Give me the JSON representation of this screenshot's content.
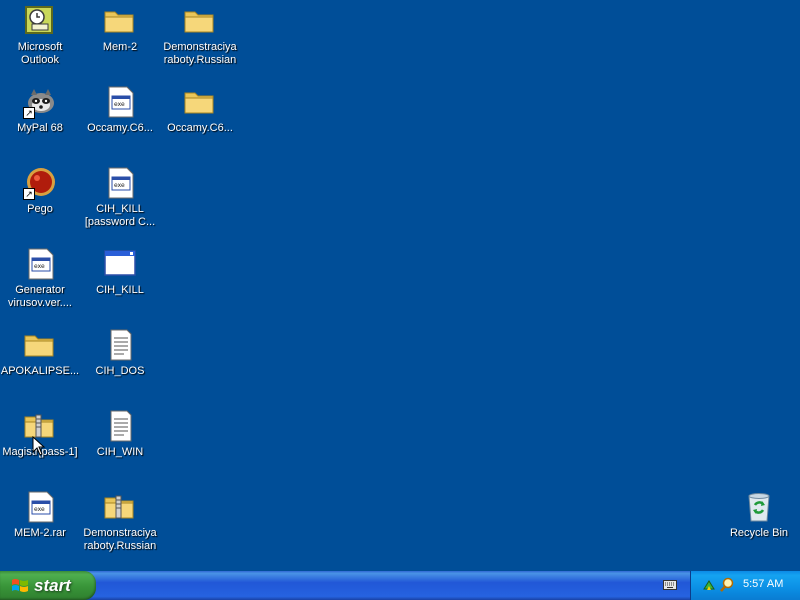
{
  "desktop": {
    "icons": [
      {
        "label": "Microsoft\nOutlook"
      },
      {
        "label": "Mem-2"
      },
      {
        "label": "Demonstraciya\nraboty.Russian"
      },
      {
        "label": "MyPal 68"
      },
      {
        "label": "Occamy.C6..."
      },
      {
        "label": "Occamy.C6..."
      },
      {
        "label": "Pego"
      },
      {
        "label": "CIH_KILL\n[password C..."
      },
      {
        "label": "Generator\nvirusov.ver...."
      },
      {
        "label": "CIH_KILL"
      },
      {
        "label": "APOKALIPSE..."
      },
      {
        "label": "CIH_DOS"
      },
      {
        "label": "Magistr[pass-1]"
      },
      {
        "label": "CIH_WIN"
      },
      {
        "label": "MEM-2.rar"
      },
      {
        "label": "Demonstraciya\nraboty.Russian"
      },
      {
        "label": "Recycle Bin"
      }
    ]
  },
  "taskbar": {
    "start_label": "start",
    "clock": "5:57 AM"
  },
  "colors": {
    "desktop_bg": "#004e98",
    "start_green": "#3c8f3c",
    "taskbar_blue": "#2157d7",
    "tray_blue": "#0b8fe4"
  }
}
